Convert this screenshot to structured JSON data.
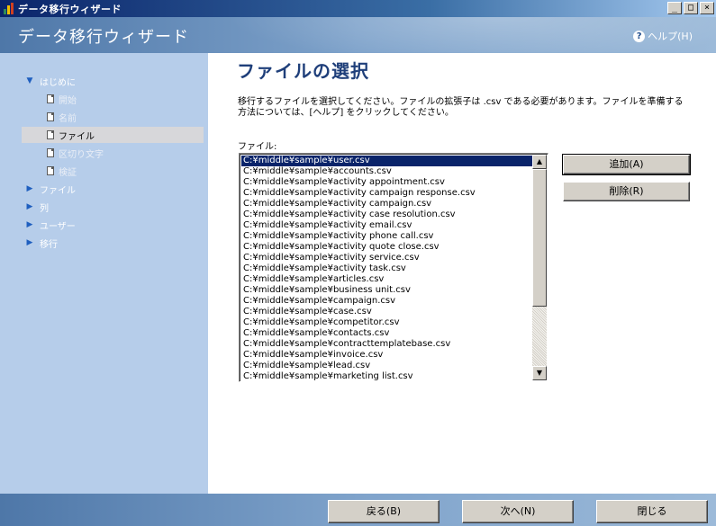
{
  "window": {
    "title": "データ移行ウィザード",
    "minimize": "_",
    "maximize": "□",
    "close": "×"
  },
  "header": {
    "title": "データ移行ウィザード",
    "help_label": "ヘルプ(H)",
    "help_icon": "?"
  },
  "nav": {
    "items": [
      {
        "label": "はじめに",
        "type": "section",
        "expanded": true,
        "arrow": "▼"
      },
      {
        "label": "開始",
        "type": "step"
      },
      {
        "label": "名前",
        "type": "step"
      },
      {
        "label": "ファイル",
        "type": "step",
        "selected": true
      },
      {
        "label": "区切り文字",
        "type": "step"
      },
      {
        "label": "検証",
        "type": "step"
      },
      {
        "label": "ファイル",
        "type": "section",
        "arrow": "▶"
      },
      {
        "label": "列",
        "type": "section",
        "arrow": "▶"
      },
      {
        "label": "ユーザー",
        "type": "section",
        "arrow": "▶"
      },
      {
        "label": "移行",
        "type": "section",
        "arrow": "▶"
      }
    ]
  },
  "main": {
    "title": "ファイルの選択",
    "description": "移行するファイルを選択してください。ファイルの拡張子は .csv である必要があります。ファイルを準備する方法については、[ヘルプ] をクリックしてください。",
    "files_label": "ファイル:",
    "files": [
      "C:¥middle¥sample¥user.csv",
      "C:¥middle¥sample¥accounts.csv",
      "C:¥middle¥sample¥activity appointment.csv",
      "C:¥middle¥sample¥activity campaign response.csv",
      "C:¥middle¥sample¥activity campaign.csv",
      "C:¥middle¥sample¥activity case resolution.csv",
      "C:¥middle¥sample¥activity email.csv",
      "C:¥middle¥sample¥activity phone call.csv",
      "C:¥middle¥sample¥activity quote close.csv",
      "C:¥middle¥sample¥activity service.csv",
      "C:¥middle¥sample¥activity task.csv",
      "C:¥middle¥sample¥articles.csv",
      "C:¥middle¥sample¥business unit.csv",
      "C:¥middle¥sample¥campaign.csv",
      "C:¥middle¥sample¥case.csv",
      "C:¥middle¥sample¥competitor.csv",
      "C:¥middle¥sample¥contacts.csv",
      "C:¥middle¥sample¥contracttemplatebase.csv",
      "C:¥middle¥sample¥invoice.csv",
      "C:¥middle¥sample¥lead.csv",
      "C:¥middle¥sample¥marketing list.csv"
    ],
    "selected_index": 0,
    "add_button": "追加(A)",
    "remove_button": "削除(R)",
    "scroll_up": "▲",
    "scroll_down": "▼"
  },
  "footer": {
    "back_button": "戻る(B)",
    "next_button": "次へ(N)",
    "close_button": "閉じる"
  },
  "colors": {
    "title_bar": "#0a246a",
    "banner": "#7fa3cb",
    "nav_bg": "#b6cdea",
    "page_title": "#1f3f7a",
    "selection": "#0a246a"
  }
}
